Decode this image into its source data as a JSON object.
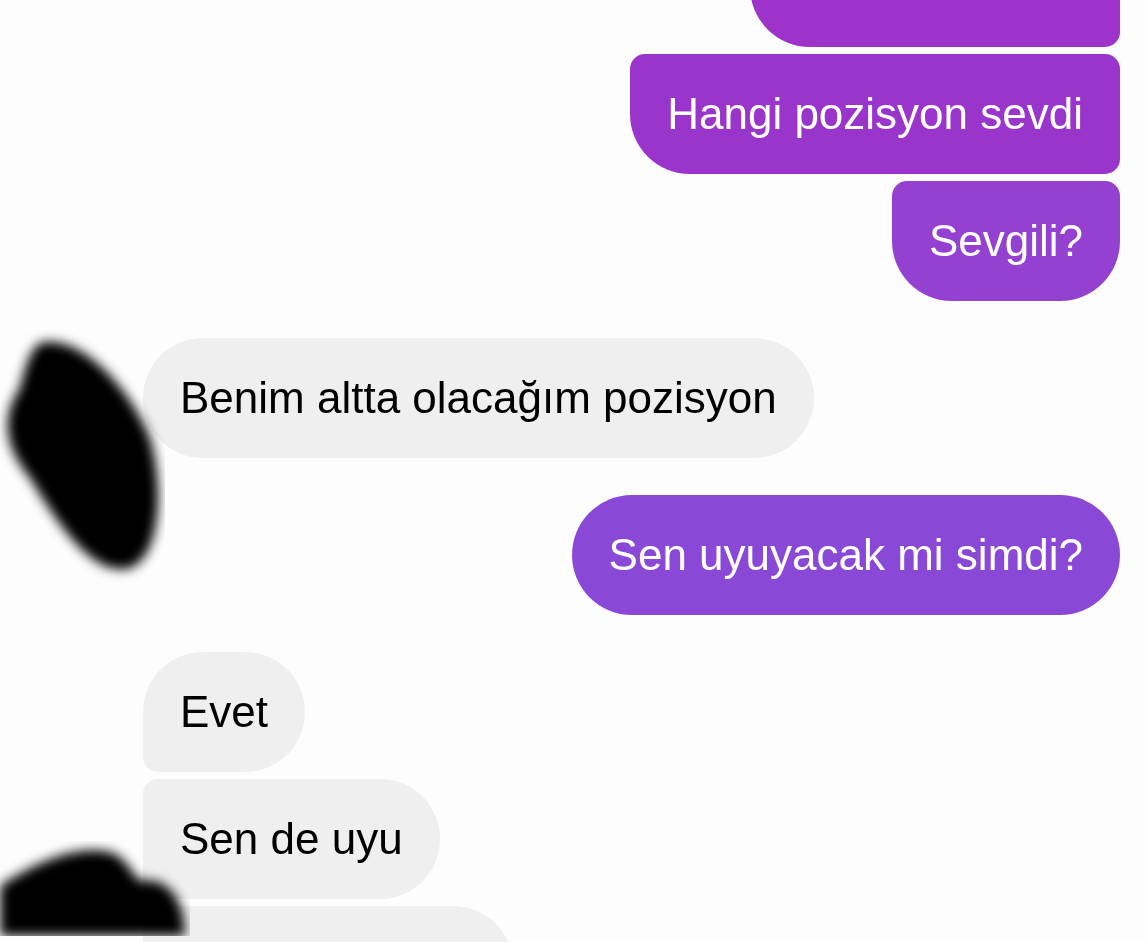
{
  "messages": [
    {
      "kind": "sent"
    },
    {
      "kind": "sent",
      "text": "Hangi pozisyon sevdi"
    },
    {
      "kind": "sent",
      "text": "Sevgili?"
    },
    {
      "kind": "received",
      "text": "Benim altta olacağım pozisyon",
      "avatar_redacted": true
    },
    {
      "kind": "sent",
      "text": "Sen uyuyacak mi simdi?"
    },
    {
      "kind": "received",
      "text": "Evet"
    },
    {
      "kind": "received",
      "text": "Sen de uyu"
    },
    {
      "kind": "received",
      "avatar_redacted": true
    }
  ]
}
